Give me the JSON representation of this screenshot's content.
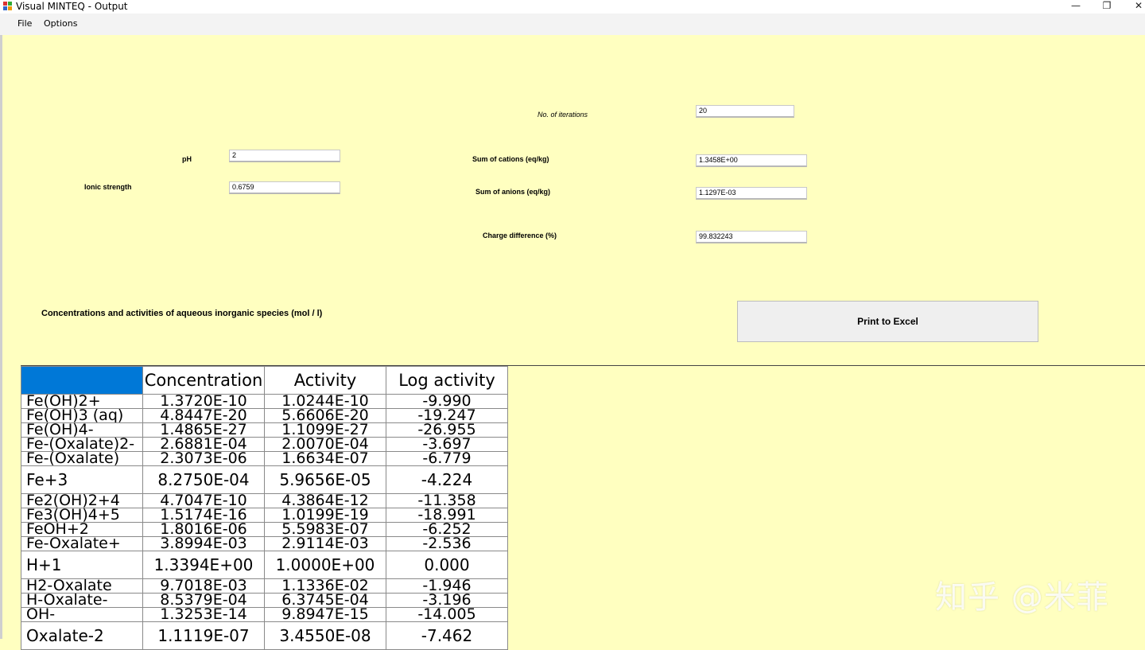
{
  "window": {
    "title": "Visual MINTEQ - Output",
    "minimize": "—",
    "restore": "❐",
    "close": "✕"
  },
  "menu": [
    "File",
    "Options"
  ],
  "fields": {
    "iterations": {
      "label": "No. of iterations",
      "value": "20"
    },
    "ph": {
      "label": "pH",
      "value": "2"
    },
    "ionic_strength": {
      "label": "Ionic strength",
      "value": "0.6759"
    },
    "sum_cations": {
      "label": "Sum of cations (eq/kg)",
      "value": "1.3458E+00"
    },
    "sum_anions": {
      "label": "Sum of anions (eq/kg)",
      "value": "1.1297E-03"
    },
    "charge_diff": {
      "label": "Charge difference (%)",
      "value": "99.832243"
    }
  },
  "section_title": "Concentrations and activities of aqueous inorganic species (mol / l)",
  "print_button": "Print to Excel",
  "table": {
    "headers": [
      "",
      "Concentration",
      "Activity",
      "Log activity"
    ],
    "rows": [
      {
        "species": "Fe(OH)2+",
        "conc": "1.3720E-10",
        "act": "1.0244E-10",
        "log": "-9.990",
        "big": false
      },
      {
        "species": "Fe(OH)3 (aq)",
        "conc": "4.8447E-20",
        "act": "5.6606E-20",
        "log": "-19.247",
        "big": false
      },
      {
        "species": "Fe(OH)4-",
        "conc": "1.4865E-27",
        "act": "1.1099E-27",
        "log": "-26.955",
        "big": false
      },
      {
        "species": "Fe-(Oxalate)2-",
        "conc": "2.6881E-04",
        "act": "2.0070E-04",
        "log": "-3.697",
        "big": false
      },
      {
        "species": "Fe-(Oxalate)",
        "conc": "2.3073E-06",
        "act": "1.6634E-07",
        "log": "-6.779",
        "big": false
      },
      {
        "species": "Fe+3",
        "conc": "8.2750E-04",
        "act": "5.9656E-05",
        "log": "-4.224",
        "big": true
      },
      {
        "species": "Fe2(OH)2+4",
        "conc": "4.7047E-10",
        "act": "4.3864E-12",
        "log": "-11.358",
        "big": false
      },
      {
        "species": "Fe3(OH)4+5",
        "conc": "1.5174E-16",
        "act": "1.0199E-19",
        "log": "-18.991",
        "big": false
      },
      {
        "species": "FeOH+2",
        "conc": "1.8016E-06",
        "act": "5.5983E-07",
        "log": "-6.252",
        "big": false
      },
      {
        "species": "Fe-Oxalate+",
        "conc": "3.8994E-03",
        "act": "2.9114E-03",
        "log": "-2.536",
        "big": false
      },
      {
        "species": "H+1",
        "conc": "1.3394E+00",
        "act": "1.0000E+00",
        "log": "0.000",
        "big": true
      },
      {
        "species": "H2-Oxalate",
        "conc": "9.7018E-03",
        "act": "1.1336E-02",
        "log": "-1.946",
        "big": false
      },
      {
        "species": "H-Oxalate-",
        "conc": "8.5379E-04",
        "act": "6.3745E-04",
        "log": "-3.196",
        "big": false
      },
      {
        "species": "OH-",
        "conc": "1.3253E-14",
        "act": "9.8947E-15",
        "log": "-14.005",
        "big": false
      },
      {
        "species": "Oxalate-2",
        "conc": "1.1119E-07",
        "act": "3.4550E-08",
        "log": "-7.462",
        "big": true
      }
    ]
  },
  "watermark": "知乎 @米菲",
  "colors": {
    "background": "#ffffc0",
    "header_selected": "#0078d7"
  }
}
